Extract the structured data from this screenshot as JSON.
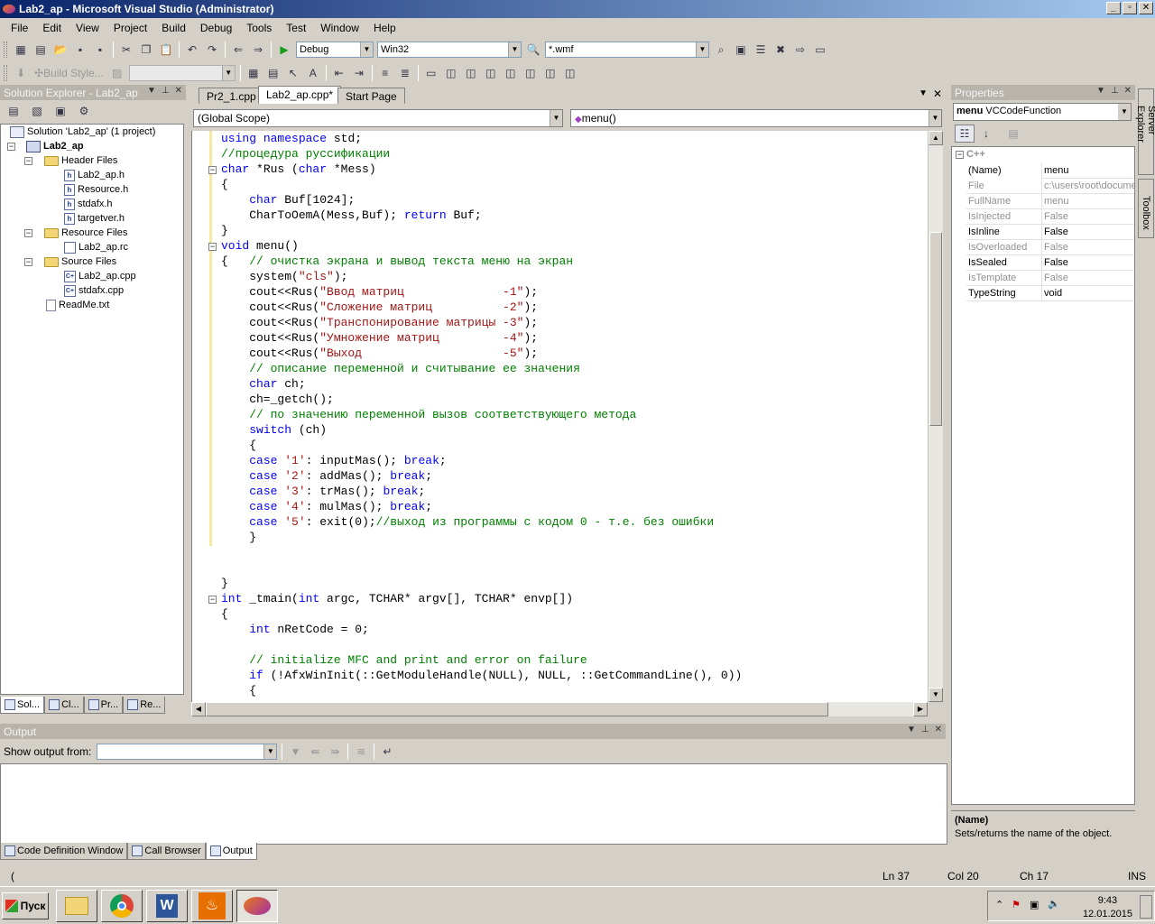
{
  "window": {
    "title": "Lab2_ap - Microsoft Visual Studio (Administrator)"
  },
  "menu": [
    "File",
    "Edit",
    "View",
    "Project",
    "Build",
    "Debug",
    "Tools",
    "Test",
    "Window",
    "Help"
  ],
  "toolbar": {
    "config": "Debug",
    "platform": "Win32",
    "find_value": "*.wmf",
    "build_style_label": "Build Style..."
  },
  "solution_explorer": {
    "title": "Solution Explorer - Lab2_ap",
    "solution": "Solution 'Lab2_ap' (1 project)",
    "project": "Lab2_ap",
    "header_folder": "Header Files",
    "header_files": [
      "Lab2_ap.h",
      "Resource.h",
      "stdafx.h",
      "targetver.h"
    ],
    "resource_folder": "Resource Files",
    "resource_files": [
      "Lab2_ap.rc"
    ],
    "source_folder": "Source Files",
    "source_files": [
      "Lab2_ap.cpp",
      "stdafx.cpp"
    ],
    "readme": "ReadMe.txt",
    "bottom_tabs": [
      "Sol...",
      "Cl...",
      "Pr...",
      "Re..."
    ]
  },
  "editor": {
    "tabs": [
      "Pr2_1.cpp",
      "Lab2_ap.cpp*",
      "Start Page"
    ],
    "scope": "(Global Scope)",
    "member": "menu()"
  },
  "properties": {
    "title": "Properties",
    "object_name": "menu",
    "object_type": "VCCodeFunction",
    "category": "C++",
    "rows": [
      {
        "name": "(Name)",
        "value": "menu"
      },
      {
        "name": "File",
        "value": "c:\\users\\root\\docume"
      },
      {
        "name": "FullName",
        "value": "menu"
      },
      {
        "name": "IsInjected",
        "value": "False"
      },
      {
        "name": "IsInline",
        "value": "False"
      },
      {
        "name": "IsOverloaded",
        "value": "False"
      },
      {
        "name": "IsSealed",
        "value": "False"
      },
      {
        "name": "IsTemplate",
        "value": "False"
      },
      {
        "name": "TypeString",
        "value": "void"
      }
    ],
    "desc_title": "(Name)",
    "desc_text": "Sets/returns the name of the object."
  },
  "side_tabs": [
    "Server Explorer",
    "Toolbox"
  ],
  "output": {
    "title": "Output",
    "show_from_label": "Show output from:",
    "tabs": [
      "Code Definition Window",
      "Call Browser",
      "Output"
    ]
  },
  "status": {
    "left": "(",
    "ln": "Ln 37",
    "col": "Col 20",
    "ch": "Ch 17",
    "mode": "INS"
  },
  "taskbar": {
    "start": "Пуск",
    "time": "9:43",
    "date": "12.01.2015"
  }
}
